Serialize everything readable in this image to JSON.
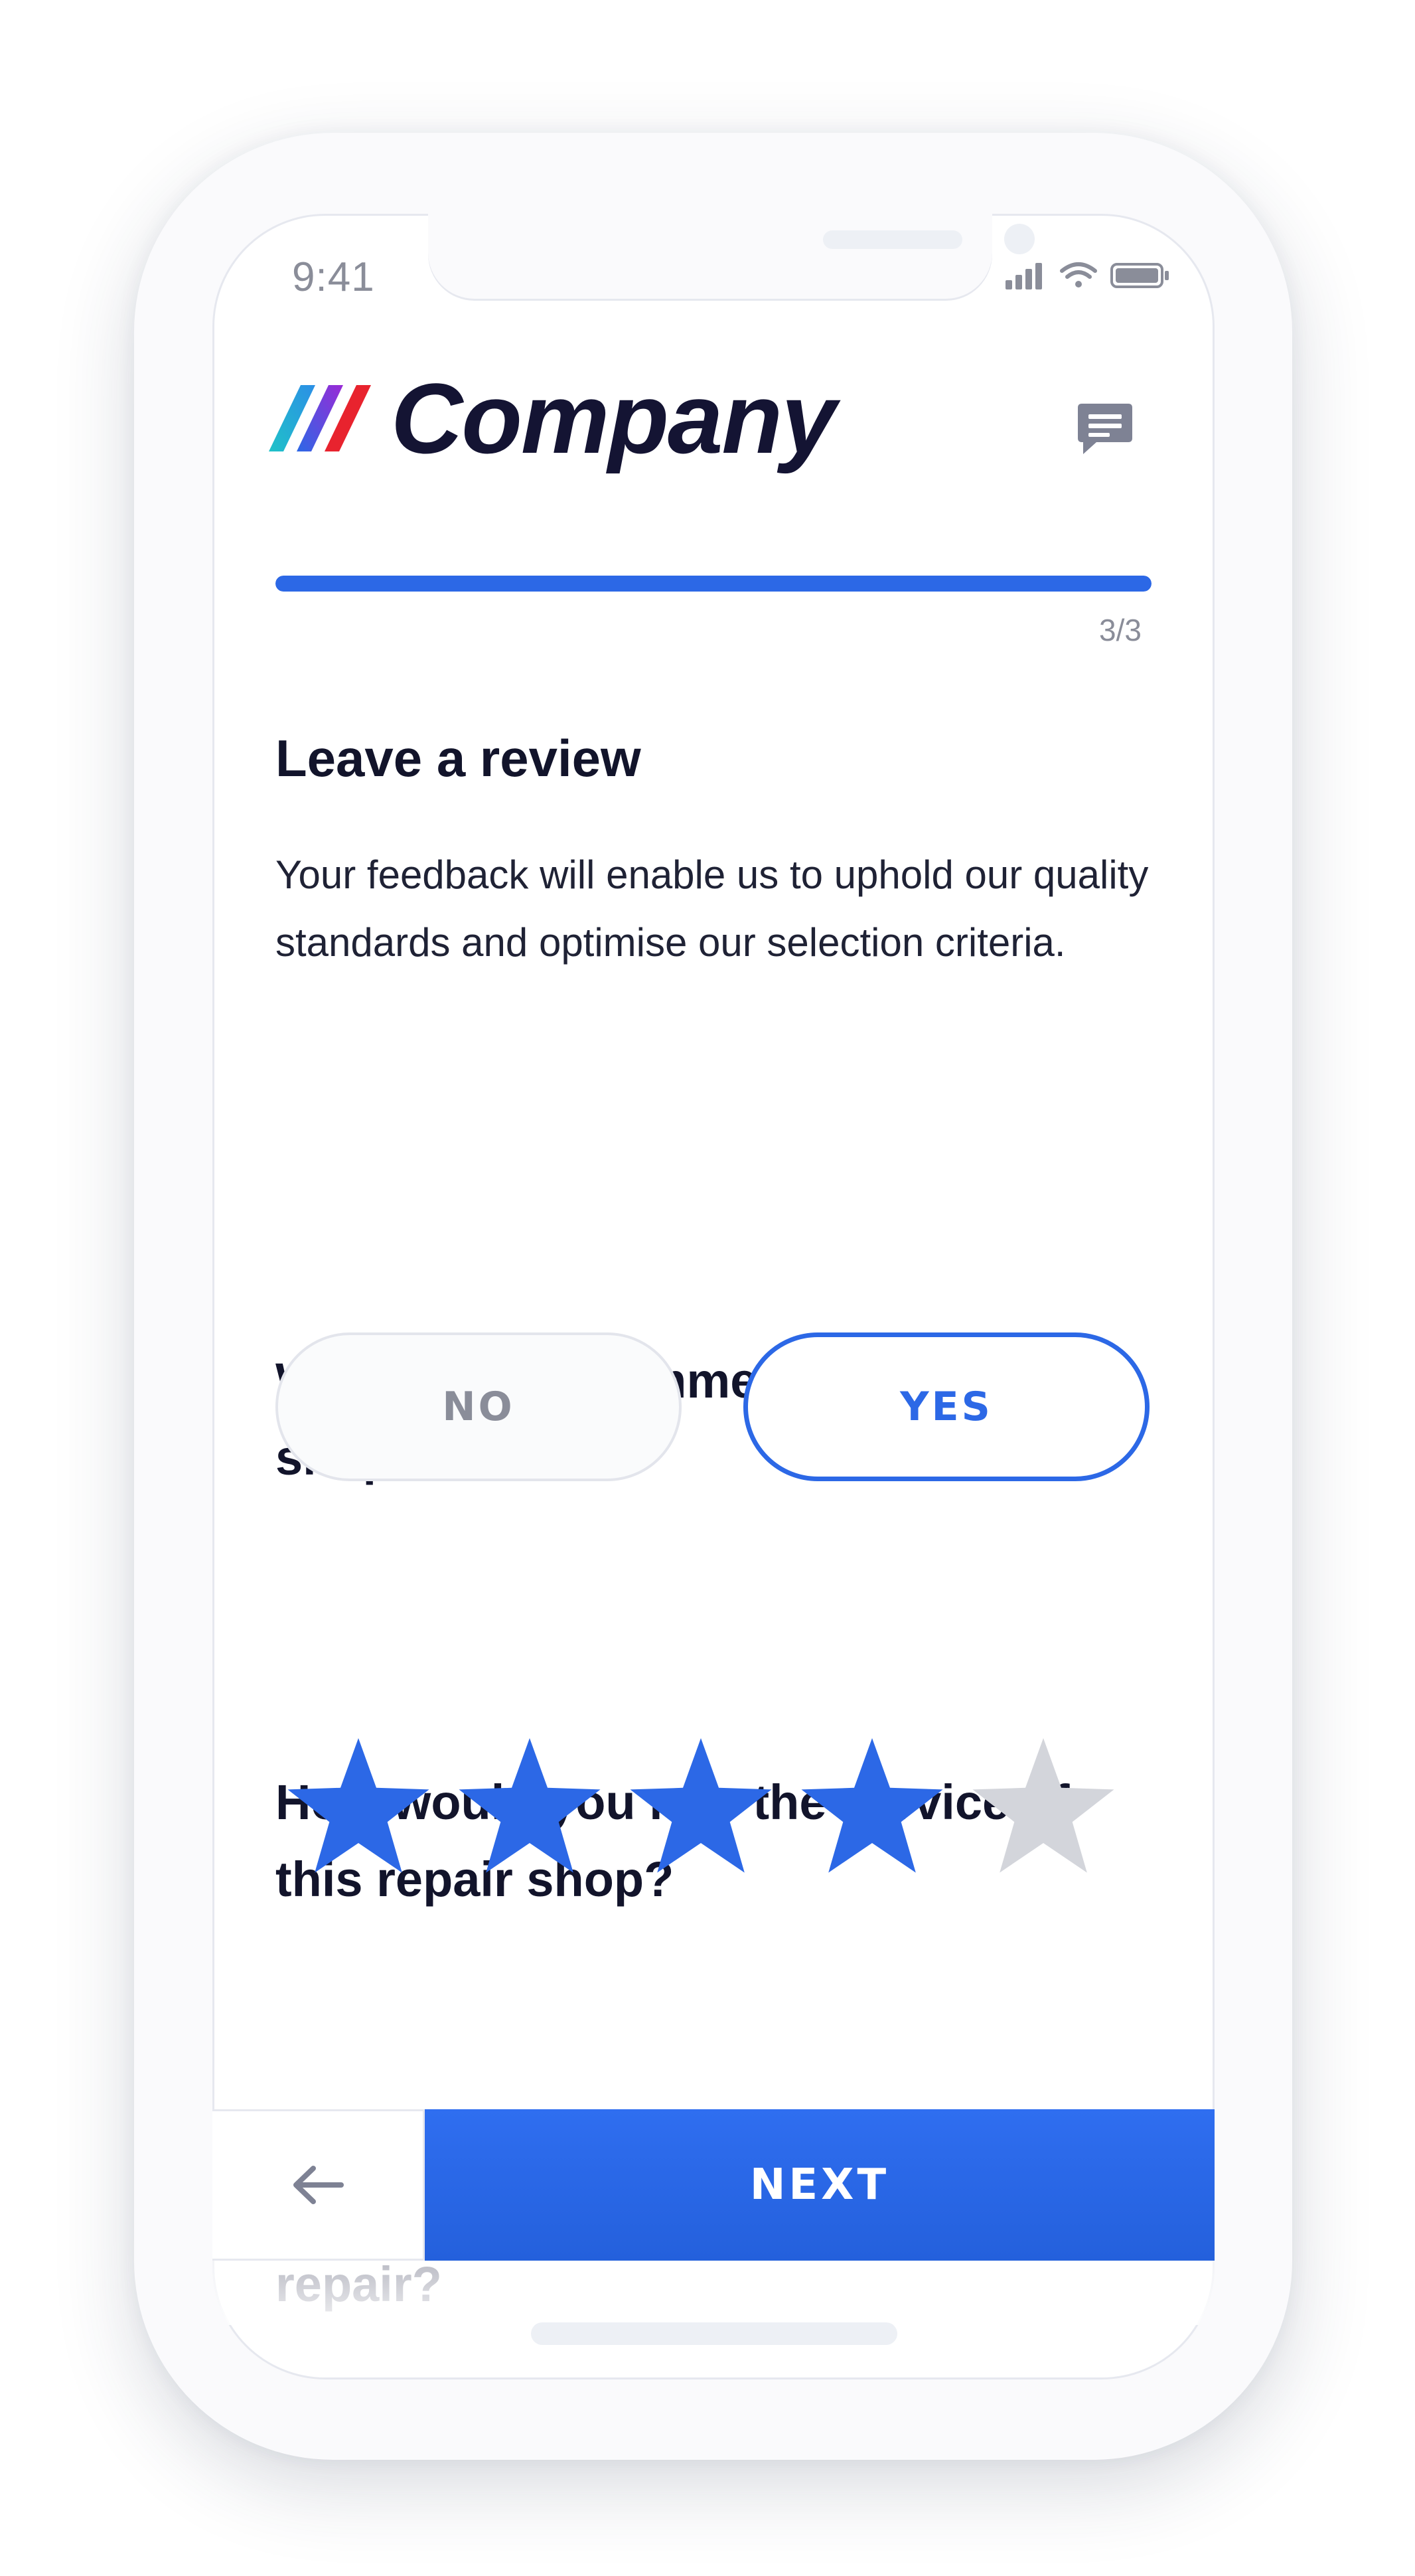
{
  "status_bar": {
    "time": "9:41",
    "icons": [
      "signal-icon",
      "wifi-icon",
      "battery-icon"
    ]
  },
  "header": {
    "logo_text": "Company",
    "logo_stripe_colors": [
      "#1fb6c9",
      "#2c68e6",
      "#e8232e"
    ],
    "chat_icon": "chat-icon"
  },
  "progress": {
    "label": "3/3",
    "fraction": 1.0
  },
  "review": {
    "title": "Leave a review",
    "description": "Your feedback will enable us to uphold our quality standards and optimise our selection criteria."
  },
  "question_recommend": {
    "text": "Would you recommend this repair shop?",
    "no_label": "NO",
    "yes_label": "YES",
    "selected": "YES"
  },
  "question_service": {
    "text": "How would you rate the service of this repair shop?",
    "rating": 4,
    "max_rating": 5
  },
  "question_quality": {
    "text": "How would you rate the quality of the repair?"
  },
  "footer": {
    "back_icon": "arrow-left-icon",
    "next_label": "NEXT"
  },
  "colors": {
    "accent": "#2c68e6",
    "star_inactive": "#d3d5db",
    "text_dark": "#12142b",
    "text_muted": "#8a8d99"
  }
}
